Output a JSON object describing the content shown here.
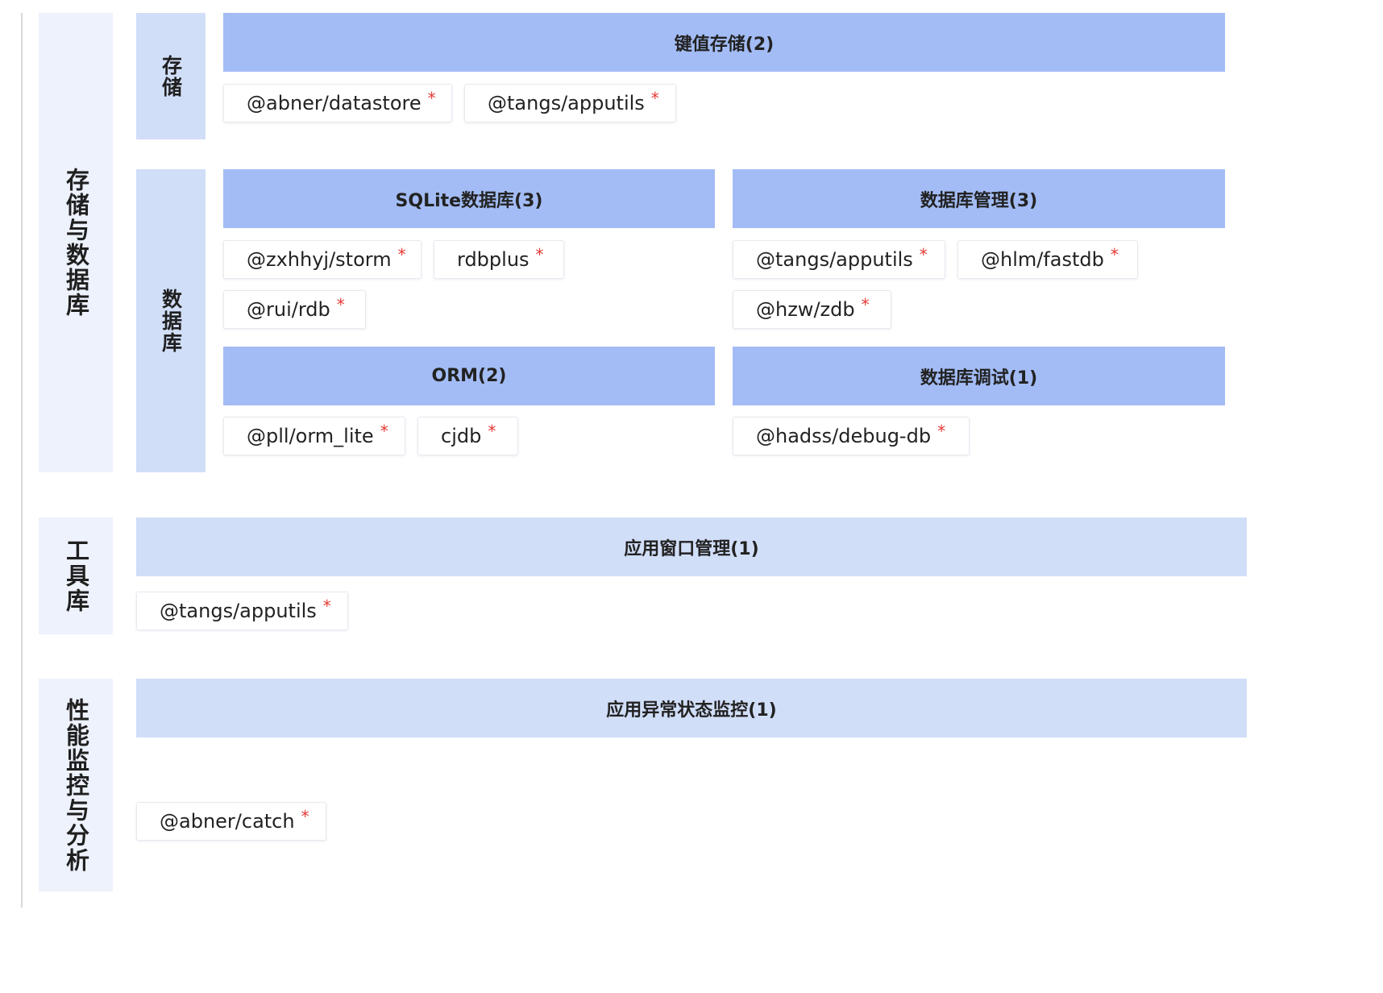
{
  "categories": {
    "storage_db": "存储与数据库",
    "toolkit": "工具库",
    "perf": "性能监控与分析"
  },
  "subcategories": {
    "storage": "存储",
    "database": "数据库"
  },
  "groups": {
    "kv": {
      "title": "键值存储(2)",
      "items": [
        "@abner/datastore",
        "@tangs/apputils"
      ]
    },
    "sqlite": {
      "title": "SQLite数据库(3)",
      "items": [
        "@zxhhyj/storm",
        "rdbplus",
        "@rui/rdb"
      ]
    },
    "dbmgmt": {
      "title": "数据库管理(3)",
      "items": [
        "@tangs/apputils",
        "@hlm/fastdb",
        "@hzw/zdb"
      ]
    },
    "orm": {
      "title": "ORM(2)",
      "items": [
        "@pll/orm_lite",
        "cjdb"
      ]
    },
    "dbdebug": {
      "title": "数据库调试(1)",
      "items": [
        "@hadss/debug-db"
      ]
    },
    "window": {
      "title": "应用窗口管理(1)",
      "items": [
        "@tangs/apputils"
      ]
    },
    "monitor": {
      "title": "应用异常状态监控(1)",
      "items": [
        "@abner/catch"
      ]
    }
  },
  "marker": "*",
  "colors": {
    "category_bg": "#edf2fd",
    "subcategory_bg": "#d1def8",
    "header_dark": "#a3bcf5",
    "header_light": "#d1def8",
    "marker": "#e53935"
  }
}
